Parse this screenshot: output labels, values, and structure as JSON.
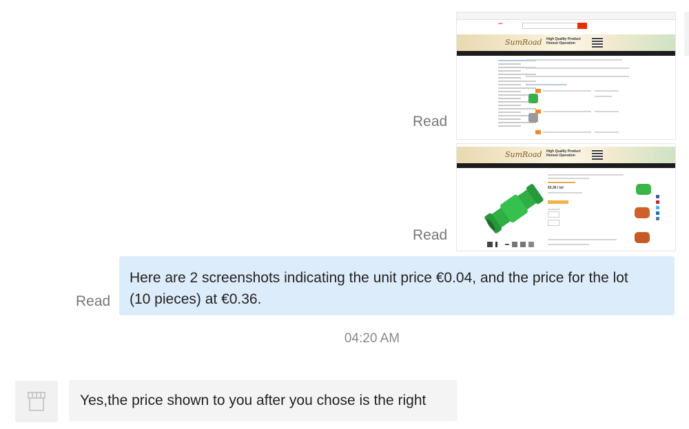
{
  "messages": [
    {
      "id": "msg-screenshot-1",
      "status": "Read",
      "attachment": {
        "site_name": "SumRoad",
        "banner_tagline_1": "High Quality Product",
        "banner_tagline_2": "Honest Operation"
      }
    },
    {
      "id": "msg-screenshot-2",
      "status": "Read",
      "attachment": {
        "site_name": "SumRoad",
        "banner_tagline_1": "High Quality Product",
        "banner_tagline_2": "Honest Operation",
        "price": "€0.36 / lot"
      }
    },
    {
      "id": "msg-text-outgoing",
      "status": "Read",
      "text_line_1": "Here are 2 screenshots indicating the unit price €0.04, and the price for the lot",
      "text_line_2": "(10 pieces) at €0.36."
    }
  ],
  "timestamp": "04:20 AM",
  "incoming": {
    "text": "Yes,the price shown to you after you chose is the right",
    "avatar_icon": "store-icon"
  },
  "colors": {
    "outgoing_bubble": "#ddecfb",
    "incoming_bubble": "#f4f4f4",
    "status_text": "#777777"
  }
}
